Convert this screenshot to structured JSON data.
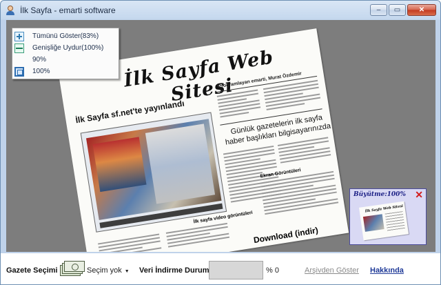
{
  "window": {
    "title": "İlk Sayfa - emarti software",
    "minimize_glyph": "–",
    "maximize_glyph": "▭",
    "close_glyph": "✕"
  },
  "zoom_menu": {
    "items": [
      {
        "label": "Tümünü Göster(83%)",
        "icon": "fit-all-icon"
      },
      {
        "label": "Genişliğe Uydur(100%)",
        "icon": "fit-width-icon"
      },
      {
        "label": "90%",
        "icon": ""
      },
      {
        "label": "100%",
        "icon": "actual-size-icon"
      }
    ]
  },
  "newspaper": {
    "masthead": "İlk Sayfa Web Sitesi",
    "author": "Programlayan emarti, Murat Özdemir",
    "headline_left": "İlk Sayfa sf.net'te yayınlandı",
    "headline_right_1": "Günlük gazetelerin ilk sayfa",
    "headline_right_2": "haber başlıkları bilgisayarınızda",
    "video_caption": "İlk sayfa video görüntüleri",
    "ekran_label": "Ekran Görüntüleri",
    "download_label": "Download (indir)"
  },
  "thumbnail": {
    "label": "Büyütme:100%",
    "close_glyph": "✕",
    "thumb_title": "İlk Sayfa Web Sitesi"
  },
  "statusbar": {
    "gazete_label": "Gazete Seçimi :",
    "selection_value": "Seçim yok",
    "selection_caret": "▼",
    "download_status_label": "Veri İndirme Durumu",
    "progress_fraction": 0,
    "percent_text": "% 0",
    "archive_link": "Arşivden Göster",
    "about_link": "Hakkında"
  },
  "colors": {
    "viewer_background": "#7d7d7d",
    "progress_fill": "#3fb44a",
    "about_link": "#1f3a98",
    "archive_link_disabled": "#8a8a8a"
  }
}
